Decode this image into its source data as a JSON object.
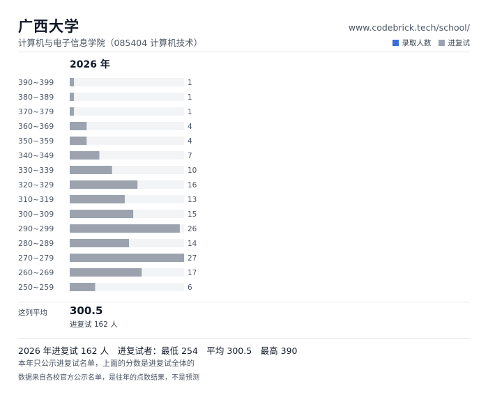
{
  "header": {
    "title": "广西大学",
    "subtitle": "计算机与电子信息学院（085404 计算机技术）",
    "site": "www.codebrick.tech/school/"
  },
  "legend": [
    {
      "label": "录取人数",
      "color": "#3b6fd8"
    },
    {
      "label": "进复试",
      "color": "#9ca3af"
    }
  ],
  "chart_data": {
    "type": "bar",
    "orientation": "horizontal",
    "title": "2026 年",
    "categories": [
      "390~399",
      "380~389",
      "370~379",
      "360~369",
      "350~359",
      "340~349",
      "330~339",
      "320~329",
      "310~319",
      "300~309",
      "290~299",
      "280~289",
      "270~279",
      "260~269",
      "250~259"
    ],
    "series": [
      {
        "name": "进复试",
        "values": [
          1,
          1,
          1,
          4,
          4,
          7,
          10,
          16,
          13,
          15,
          26,
          14,
          27,
          17,
          6
        ],
        "color": "#9ca3af"
      }
    ],
    "xlim": [
      0,
      27
    ],
    "track_color": "#f3f4f6"
  },
  "average": {
    "label": "这列平均",
    "value": "300.5",
    "sub": "进复试 162 人"
  },
  "footer": {
    "summary": "2026 年进复试 162 人　进复试者：最低 254　平均 300.5　最高 390",
    "note1": "本年只公示进复试名单，上面的分数是进复试全体的",
    "note2": "数据来自各校官方公示名单，是往年的点数结果，不是预测"
  }
}
